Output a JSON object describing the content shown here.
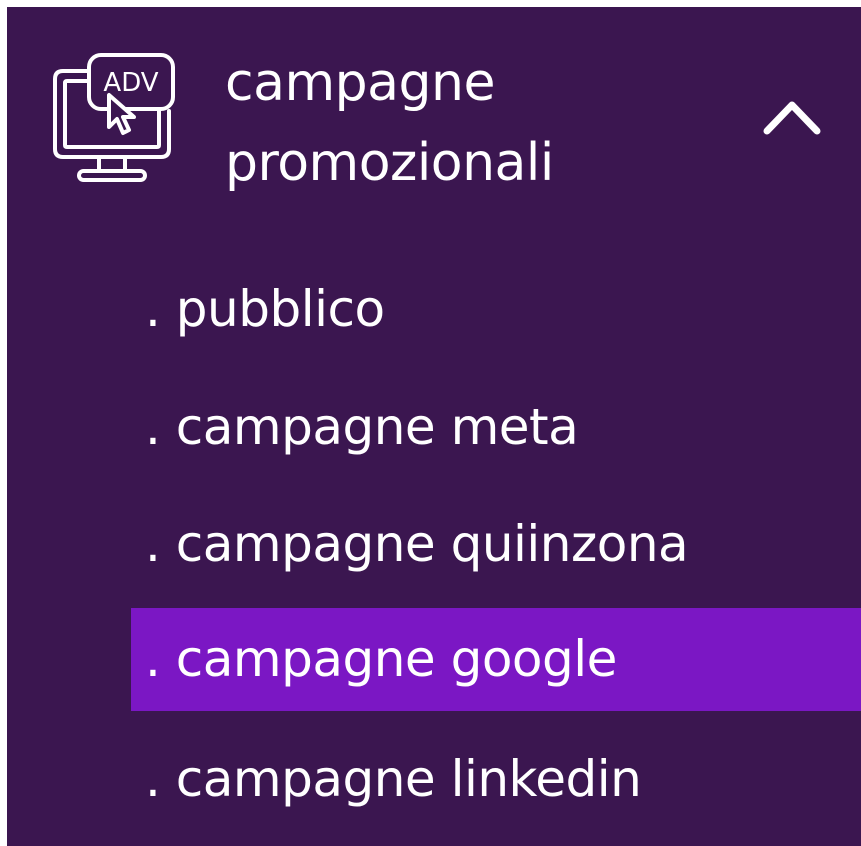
{
  "section": {
    "icon": "adv-monitor-icon",
    "icon_text": "ADV",
    "title_line1": "campagne",
    "title_line2": "promozionali",
    "expanded": true,
    "toggle_icon": "chevron-up-icon"
  },
  "items": [
    {
      "label": ". pubblico",
      "active": false
    },
    {
      "label": ". campagne meta",
      "active": false
    },
    {
      "label": ". campagne quiinzona",
      "active": false
    },
    {
      "label": ". campagne google",
      "active": true
    },
    {
      "label": ". campagne linkedin",
      "active": false
    }
  ],
  "colors": {
    "background": "#3b1650",
    "active_background": "#7b17c4",
    "text": "#ffffff"
  }
}
